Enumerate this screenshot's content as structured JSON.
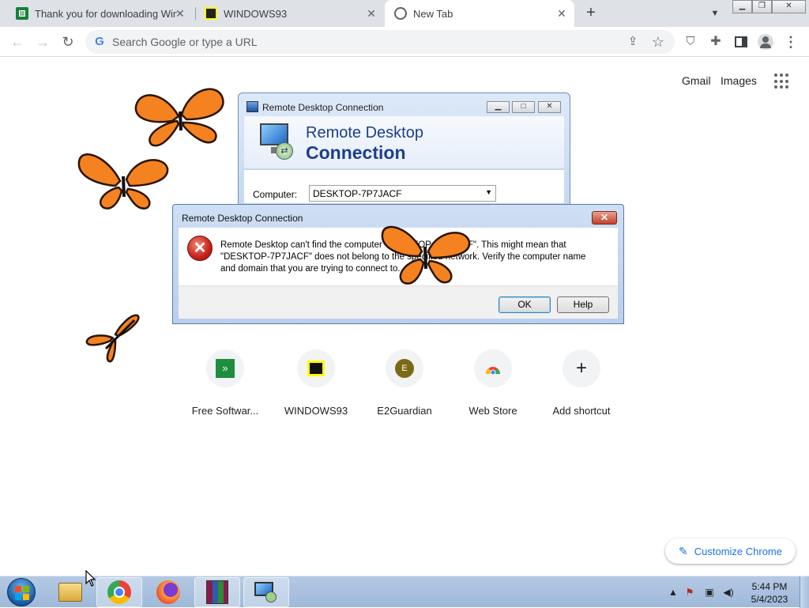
{
  "browser": {
    "tabs": [
      {
        "title": "Thank you for downloading WinF",
        "active": false
      },
      {
        "title": "WINDOWS93",
        "active": false
      },
      {
        "title": "New Tab",
        "active": true
      }
    ],
    "omnibox": {
      "placeholder": "Search Google or type a URL"
    }
  },
  "newtab": {
    "top_links": {
      "gmail": "Gmail",
      "images": "Images"
    },
    "shortcuts": [
      {
        "label": "Free Softwar...",
        "icon": "green-download-icon"
      },
      {
        "label": "WINDOWS93",
        "icon": "windows93-icon"
      },
      {
        "label": "E2Guardian",
        "icon": "letter-avatar",
        "letter": "E"
      },
      {
        "label": "Web Store",
        "icon": "chrome-webstore-icon"
      },
      {
        "label": "Add shortcut",
        "icon": "plus-icon"
      }
    ],
    "customize_label": "Customize Chrome"
  },
  "rdp_window": {
    "title": "Remote Desktop Connection",
    "heading_line1": "Remote Desktop",
    "heading_line2": "Connection",
    "computer_label": "Computer:",
    "computer_value": "DESKTOP-7P7JACF"
  },
  "error_dialog": {
    "title": "Remote Desktop Connection",
    "message_line1": "Remote Desktop can't find the computer \"DESKTOP-7P7JACF\". This might mean that",
    "message_line2": "\"DESKTOP-7P7JACF\" does not belong to the specified network.  Verify the computer name",
    "message_line3": "and domain that you are trying to connect to.",
    "ok_label": "OK",
    "help_label": "Help"
  },
  "taskbar": {
    "apps": [
      "file-explorer-icon",
      "chrome-icon",
      "firefox-icon",
      "winrar-icon",
      "remote-desktop-icon"
    ],
    "clock_time": "5:44 PM",
    "clock_date": "5/4/2023"
  },
  "colors": {
    "accent": "#1a73e8",
    "rdp_heading": "#1e3e8c",
    "error_red": "#c6201a"
  }
}
